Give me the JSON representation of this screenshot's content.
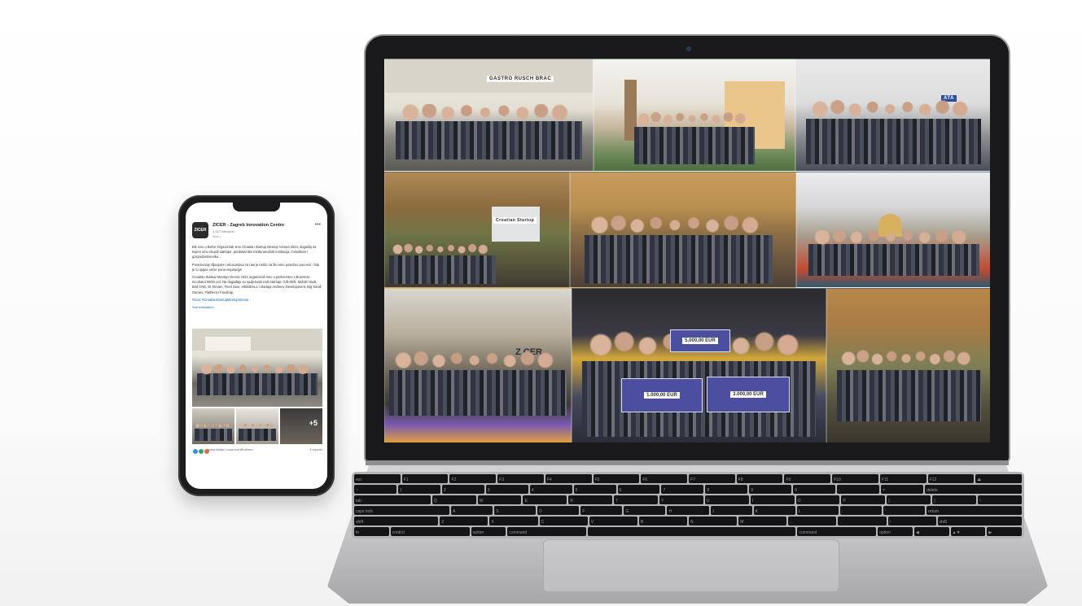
{
  "phone": {
    "org_logo_text": "ZICER",
    "org_name": "ZICER - Zagreb Innovation Centre",
    "followers": "4,427 followers",
    "time": "1mo •",
    "more_icon": "•••",
    "paragraphs": [
      "Bili smo u Beču! Organizirali smo Croatian Startup Meetup Vienna 2024, događaj na kojem smo okupili startupe, predstavnike međunarodnih institucija, investitore i gospodarstvenike.",
      "Povezivanje dijaspore i ekosustava za nas je nešto na što smo posebno ponosni - bila je to sjajna večer puna inspiracije!",
      "Croatian Startup Meetup Vienna 2024 organizirali smo u partnerstvu s Business Incubator BIOS Ltd. Na događaju su sudjelovali naši startupi: Gift-Shift, Mobile Vault, Bird CNE, Di Stream, Fleet Sine, HEIMDALL i startupi Andreev Development, Big Small Games, FlatRent i Fanstrap.",
      "#zicer #CroatianStartupMeetupVienna"
    ],
    "see_translation": "See translation",
    "more_photos": "+5",
    "reaction_names": "Ivana Matija Lucija and 88 others",
    "reposts": "4 reposts"
  },
  "laptop": {
    "photos": [
      {
        "label": "GASTRO RUSCH BRAC"
      },
      {
        "label": ""
      },
      {
        "label": "ATA"
      },
      {
        "label": "Croatian Startup"
      },
      {
        "label": ""
      },
      {
        "label": ""
      },
      {
        "label": "Z CER"
      },
      {
        "label": "5.000,00 EUR"
      },
      {
        "label": ""
      }
    ],
    "cheques": [
      {
        "amount": "5.000,00 EUR"
      },
      {
        "amount": "1.000,00 EUR"
      },
      {
        "amount": "3.000,00 EUR"
      }
    ]
  },
  "keyboard": {
    "rows": [
      [
        "esc",
        "F1",
        "F2",
        "F3",
        "F4",
        "F5",
        "F6",
        "F7",
        "F8",
        "F9",
        "F10",
        "F11",
        "F12",
        "⏏"
      ],
      [
        "~",
        "1",
        "2",
        "3",
        "4",
        "5",
        "6",
        "7",
        "8",
        "9",
        "0",
        "-",
        "=",
        "delete"
      ],
      [
        "tab",
        "Q",
        "W",
        "E",
        "R",
        "T",
        "Y",
        "U",
        "I",
        "O",
        "P",
        "[",
        "]",
        "\\"
      ],
      [
        "caps lock",
        "A",
        "S",
        "D",
        "F",
        "G",
        "H",
        "J",
        "K",
        "L",
        ";",
        "'",
        "return"
      ],
      [
        "shift",
        "Z",
        "X",
        "C",
        "V",
        "B",
        "N",
        "M",
        ",",
        ".",
        "/",
        "shift"
      ],
      [
        "fn",
        "control",
        "option",
        "command",
        "",
        "command",
        "option",
        "◀",
        "▲▼",
        "▶"
      ]
    ]
  },
  "colors": {
    "phone_body": "#1d1d1f",
    "link": "#0a66c2",
    "laptop_bezel": "#1a1a1c",
    "laptop_base": "#c2c2c4"
  }
}
